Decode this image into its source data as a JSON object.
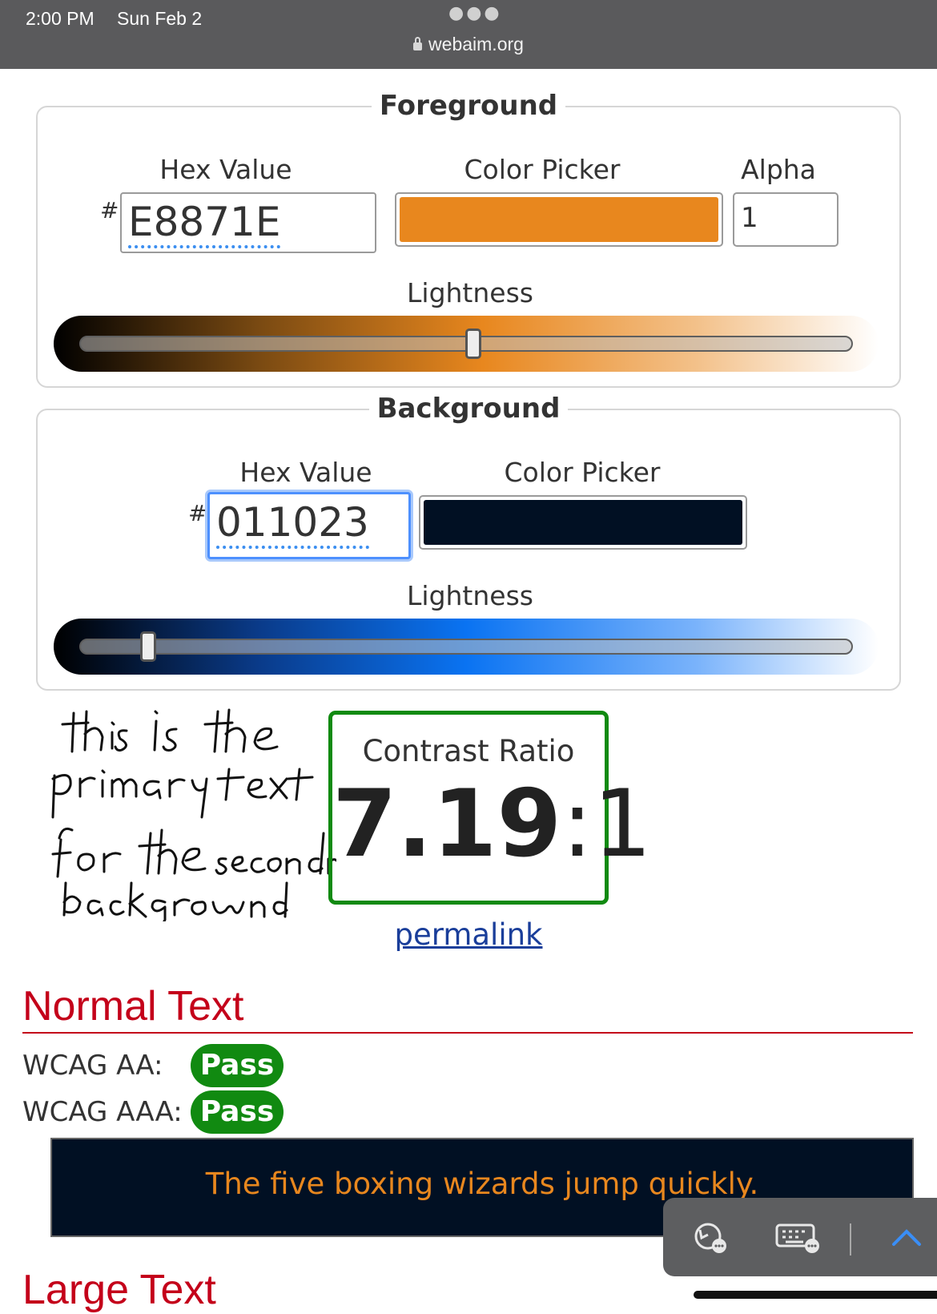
{
  "status_bar": {
    "time": "2:00 PM",
    "date": "Sun Feb 2",
    "url": "webaim.org"
  },
  "foreground": {
    "legend": "Foreground",
    "hex_label": "Hex Value",
    "hash": "#",
    "hex_value": "E8871E",
    "picker_label": "Color Picker",
    "picker_color": "#E8871E",
    "alpha_label": "Alpha",
    "alpha_value": "1",
    "lightness_label": "Lightness",
    "lightness_fraction": 0.51
  },
  "background": {
    "legend": "Background",
    "hex_label": "Hex Value",
    "hash": "#",
    "hex_value": "011023",
    "picker_label": "Color Picker",
    "picker_color": "#011023",
    "lightness_label": "Lightness",
    "lightness_fraction": 0.08
  },
  "handwritten_note": "this is the primary text for the secondary background",
  "contrast": {
    "title": "Contrast Ratio",
    "ratio_main": "7.19",
    "ratio_suffix": ":1",
    "permalink": "permalink"
  },
  "normal_text": {
    "heading": "Normal Text",
    "aa_label": "WCAG AA:",
    "aa_result": "Pass",
    "aaa_label": "WCAG AAA:",
    "aaa_result": "Pass",
    "sample": "The five boxing wizards jump quickly."
  },
  "large_text": {
    "heading": "Large Text"
  },
  "colors": {
    "pass": "#118A11",
    "heading_red": "#C4001A",
    "link": "#1A3E9A",
    "focus": "#4D90FE"
  }
}
